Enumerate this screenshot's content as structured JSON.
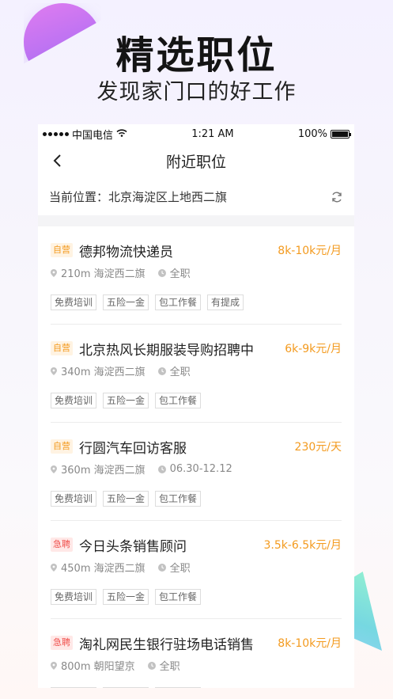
{
  "hero": {
    "title": "精选职位",
    "subtitle": "发现家门口的好工作"
  },
  "status_bar": {
    "carrier": "中国电信",
    "time": "1:21 AM",
    "battery": "100%"
  },
  "nav": {
    "title": "附近职位",
    "back_icon": "chevron-left-icon"
  },
  "location": {
    "text": "当前位置：北京海淀区上地西二旗",
    "refresh_icon": "refresh-icon"
  },
  "colors": {
    "salary": "#f39a1e",
    "badge_self": "#f39a1e",
    "badge_urgent": "#f0524f",
    "hero_purple": "#9b6af4",
    "hero_teal": "#8ef0cf"
  },
  "jobs": [
    {
      "badge": "自营",
      "badge_type": "orange",
      "title": "德邦物流快递员",
      "salary": "8k-10k元/月",
      "distance": "210m 海淀西二旗",
      "detail": "全职",
      "tags": [
        "免费培训",
        "五险一金",
        "包工作餐",
        "有提成"
      ]
    },
    {
      "badge": "自营",
      "badge_type": "orange",
      "title": "北京热风长期服装导购招聘中",
      "salary": "6k-9k元/月",
      "distance": "340m 海淀西二旗",
      "detail": "全职",
      "tags": [
        "免费培训",
        "五险一金",
        "包工作餐"
      ]
    },
    {
      "badge": "自营",
      "badge_type": "orange",
      "title": "行圆汽车回访客服",
      "salary": "230元/天",
      "distance": "360m 海淀西二旗",
      "detail": "06.30-12.12",
      "tags": [
        "免费培训",
        "五险一金",
        "包工作餐"
      ]
    },
    {
      "badge": "急聘",
      "badge_type": "red",
      "title": "今日头条销售顾问",
      "salary": "3.5k-6.5k元/月",
      "distance": "450m 海淀西二旗",
      "detail": "全职",
      "tags": [
        "免费培训",
        "五险一金",
        "包工作餐"
      ]
    },
    {
      "badge": "急聘",
      "badge_type": "red",
      "title": "淘礼网民生银行驻场电话销售",
      "salary": "8k-10k元/月",
      "distance": "800m 朝阳望京",
      "detail": "全职",
      "tags": [
        "免费培训",
        "五险一金",
        "包工作餐"
      ]
    }
  ]
}
